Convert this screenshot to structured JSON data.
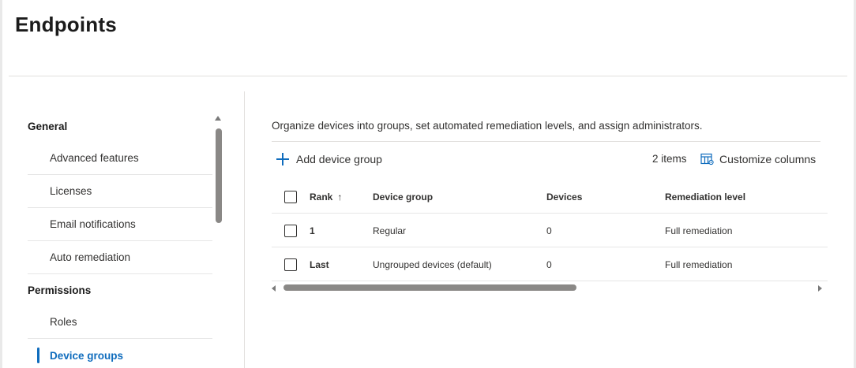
{
  "page": {
    "title": "Endpoints"
  },
  "sidebar": {
    "sections": [
      {
        "label": "General",
        "items": [
          "Advanced features",
          "Licenses",
          "Email notifications",
          "Auto remediation"
        ]
      },
      {
        "label": "Permissions",
        "items": [
          "Roles",
          "Device groups"
        ]
      }
    ],
    "selected": "Device groups"
  },
  "main": {
    "description": "Organize devices into groups, set automated remediation levels, and assign administrators.",
    "toolbar": {
      "add_label": "Add device group",
      "count": "2 items",
      "customize_label": "Customize columns"
    },
    "table": {
      "columns": [
        "Rank",
        "Device group",
        "Devices",
        "Remediation level"
      ],
      "sort_indicator": "↑",
      "rows": [
        {
          "rank": "1",
          "group": "Regular",
          "devices": "0",
          "remediation": "Full remediation"
        },
        {
          "rank": "Last",
          "group": "Ungrouped devices (default)",
          "devices": "0",
          "remediation": "Full remediation"
        }
      ]
    }
  },
  "colors": {
    "accent": "#0f6cbd",
    "text": "#323130",
    "divider": "#e1dfdd"
  },
  "icons": [
    "plus-icon",
    "customize-columns-icon",
    "sort-ascending-icon",
    "scroll-up-icon",
    "scroll-left-icon",
    "scroll-right-icon"
  ]
}
